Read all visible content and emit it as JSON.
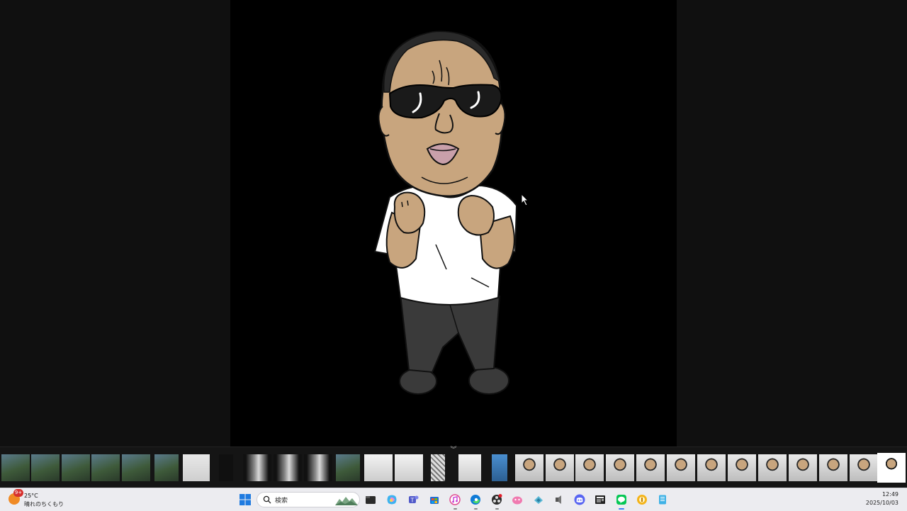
{
  "viewer": {
    "image_subject": "cartoon man with sunglasses and white t-shirt",
    "colors": {
      "skin": "#c8a57e",
      "shirt": "#ffffff",
      "pants": "#3a3a3a",
      "glasses": "#1a1a1a",
      "lips": "#c9a0aa"
    }
  },
  "filmstrip": {
    "collapse_icon": "chevron-double-down-icon",
    "selected_index": 31,
    "thumbnails": [
      "photo-thumbnail",
      "photo-thumbnail",
      "photo-thumbnail",
      "photo-thumbnail",
      "photo-thumbnail",
      "photo-thumbnail",
      "sketch-thumbnail",
      "dark-thumbnail",
      "video-thumbnail",
      "video-thumbnail",
      "video-thumbnail",
      "photo-thumbnail",
      "document-thumbnail",
      "document-thumbnail",
      "qr-thumbnail",
      "document-thumbnail",
      "phone-thumbnail",
      "character-thumbnail",
      "character-thumbnail",
      "character-thumbnail",
      "character-thumbnail",
      "character-thumbnail",
      "character-thumbnail",
      "character-thumbnail",
      "character-thumbnail",
      "character-thumbnail",
      "character-thumbnail",
      "character-thumbnail",
      "character-thumbnail",
      "character-thumbnail",
      "character-thumbnail",
      "character-thumbnail"
    ]
  },
  "taskbar": {
    "weather": {
      "badge": "9+",
      "temperature": "25°C",
      "description": "晴れのちくもり"
    },
    "search": {
      "placeholder": "検索"
    },
    "apps": [
      {
        "name": "file-explorer-icon",
        "state": "none"
      },
      {
        "name": "copilot-icon",
        "state": "none"
      },
      {
        "name": "teams-icon",
        "state": "none"
      },
      {
        "name": "microsoft-store-icon",
        "state": "none"
      },
      {
        "name": "itunes-icon",
        "state": "open"
      },
      {
        "name": "edge-icon",
        "state": "open"
      },
      {
        "name": "obs-icon",
        "state": "open"
      },
      {
        "name": "pink-app-icon",
        "state": "none"
      },
      {
        "name": "network-app-icon",
        "state": "none"
      },
      {
        "name": "audio-app-icon",
        "state": "none"
      },
      {
        "name": "discord-icon",
        "state": "none"
      },
      {
        "name": "news-app-icon",
        "state": "none"
      },
      {
        "name": "line-icon",
        "state": "active"
      },
      {
        "name": "yellow-app-icon",
        "state": "none"
      },
      {
        "name": "notepad-icon",
        "state": "none"
      }
    ],
    "clock": {
      "time": "12:49",
      "date": "2025/10/03"
    },
    "accent": "#3b82f6"
  }
}
